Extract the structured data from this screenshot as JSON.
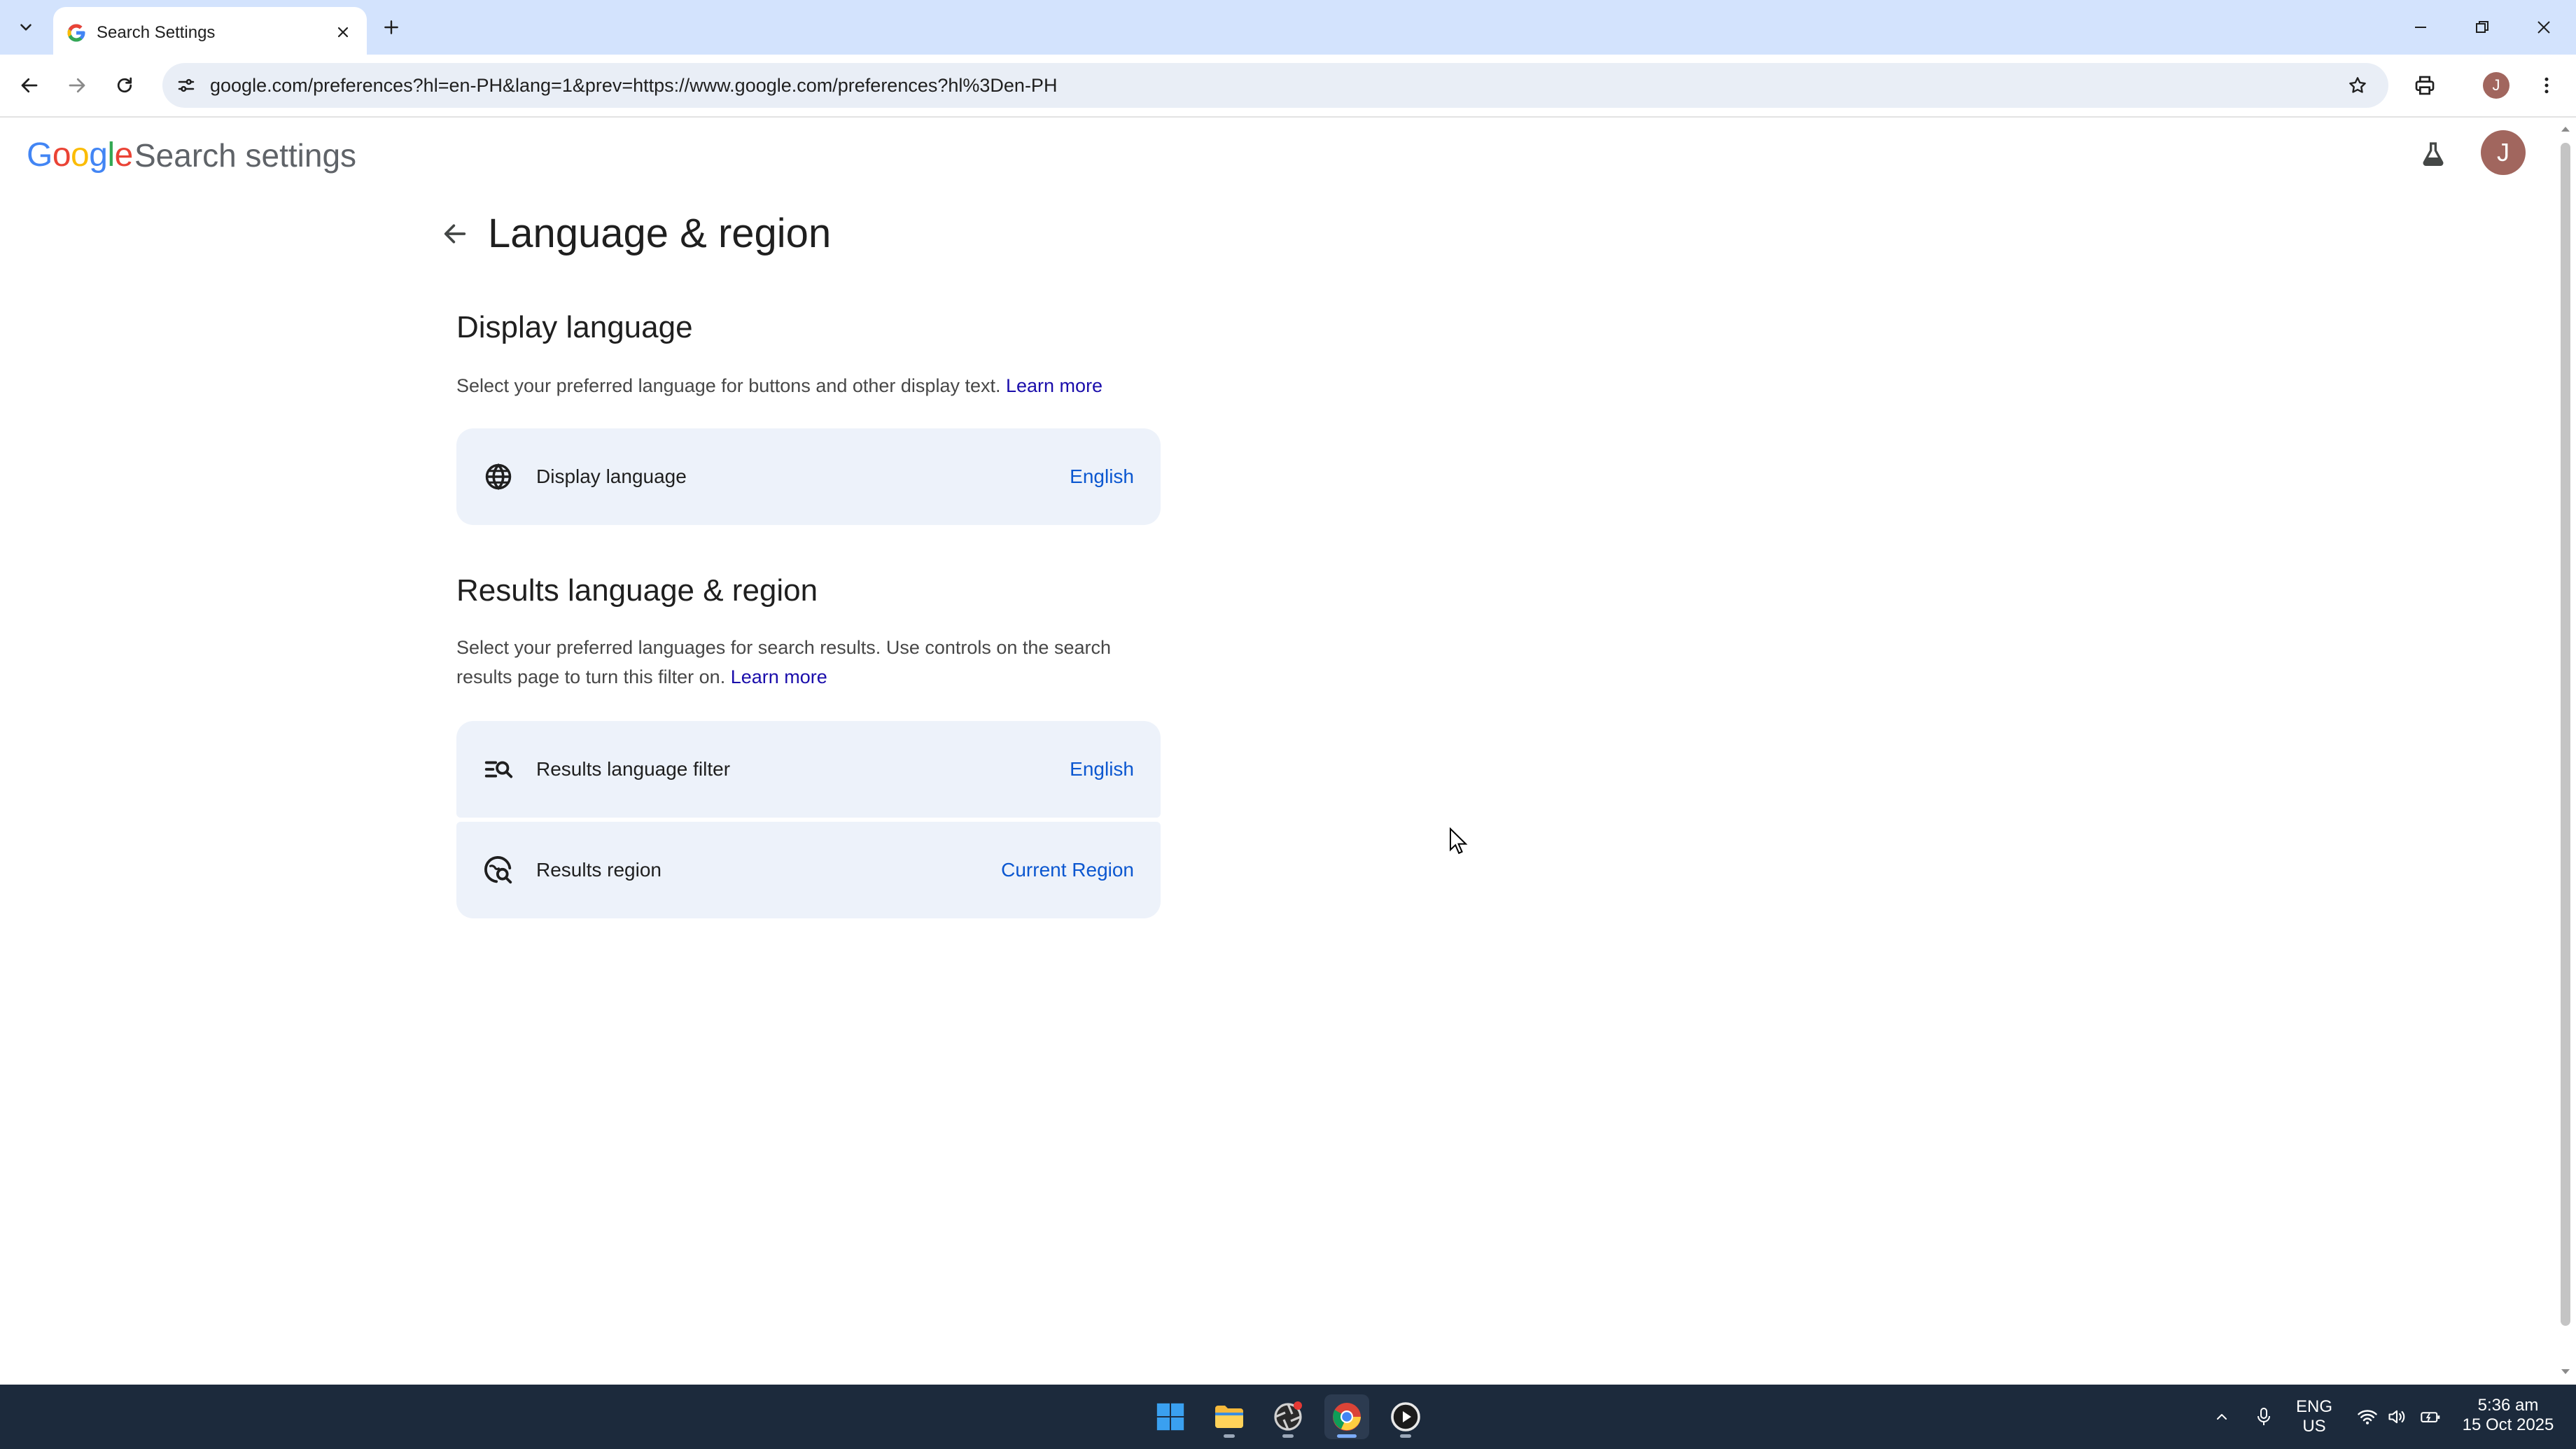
{
  "browser": {
    "tab": {
      "title": "Search Settings"
    },
    "url": "google.com/preferences?hl=en-PH&lang=1&prev=https://www.google.com/preferences?hl%3Den-PH",
    "profile_initial": "J"
  },
  "header": {
    "logo_letters": [
      {
        "char": "G",
        "color": "#4285F4"
      },
      {
        "char": "o",
        "color": "#EA4335"
      },
      {
        "char": "o",
        "color": "#FBBC05"
      },
      {
        "char": "g",
        "color": "#4285F4"
      },
      {
        "char": "l",
        "color": "#34A853"
      },
      {
        "char": "e",
        "color": "#EA4335"
      }
    ],
    "title": "Search settings",
    "avatar_initial": "J"
  },
  "page": {
    "title": "Language & region",
    "display_language": {
      "heading": "Display language",
      "description": "Select your preferred language for buttons and other display text.",
      "learn_more": "Learn more",
      "card": {
        "icon": "globe-icon",
        "label": "Display language",
        "value": "English"
      }
    },
    "results": {
      "heading": "Results language & region",
      "description": "Select your preferred languages for search results. Use controls on the search results page to turn this filter on.",
      "learn_more": "Learn more",
      "cards": [
        {
          "icon": "search-filter-icon",
          "label": "Results language filter",
          "value": "English"
        },
        {
          "icon": "region-search-icon",
          "label": "Results region",
          "value": "Current Region"
        }
      ]
    }
  },
  "taskbar": {
    "lang_primary": "ENG",
    "lang_secondary": "US",
    "time": "5:36 am",
    "date": "15 Oct 2025"
  },
  "colors": {
    "tabstrip": "#d3e3fd",
    "card_bg": "#edf2fa",
    "link": "#1a0dab",
    "value_blue": "#0b57d0",
    "avatar": "#a1665e",
    "taskbar": "#1c2a3c"
  }
}
